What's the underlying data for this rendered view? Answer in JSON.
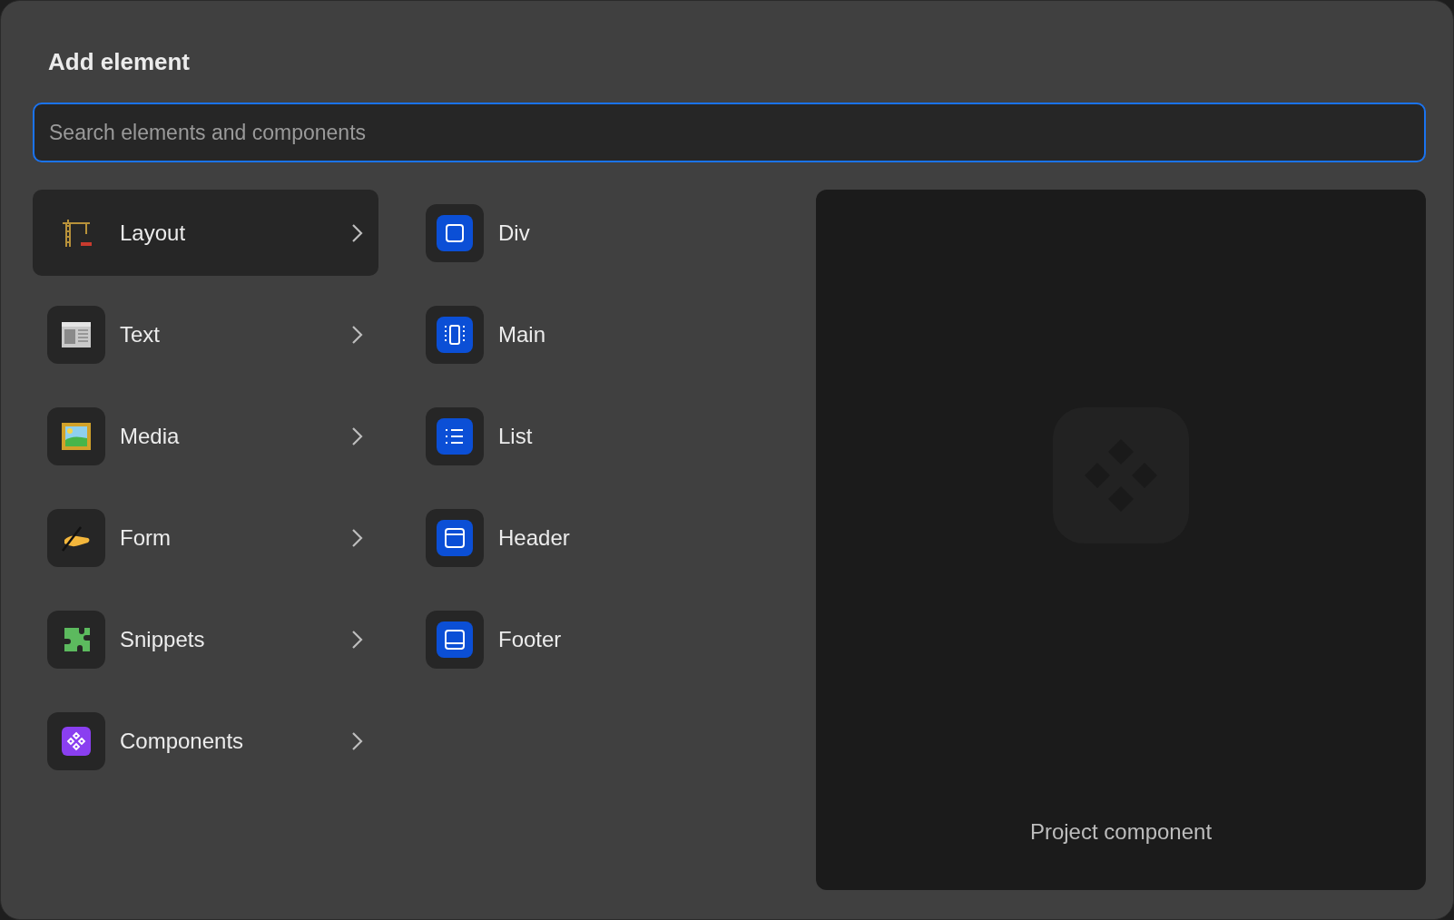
{
  "dialog": {
    "title": "Add element"
  },
  "search": {
    "placeholder": "Search elements and components"
  },
  "categories": [
    {
      "label": "Layout",
      "selected": true
    },
    {
      "label": "Text",
      "selected": false
    },
    {
      "label": "Media",
      "selected": false
    },
    {
      "label": "Form",
      "selected": false
    },
    {
      "label": "Snippets",
      "selected": false
    },
    {
      "label": "Components",
      "selected": false
    }
  ],
  "elements": [
    {
      "label": "Div"
    },
    {
      "label": "Main"
    },
    {
      "label": "List"
    },
    {
      "label": "Header"
    },
    {
      "label": "Footer"
    }
  ],
  "preview": {
    "caption": "Project component"
  }
}
